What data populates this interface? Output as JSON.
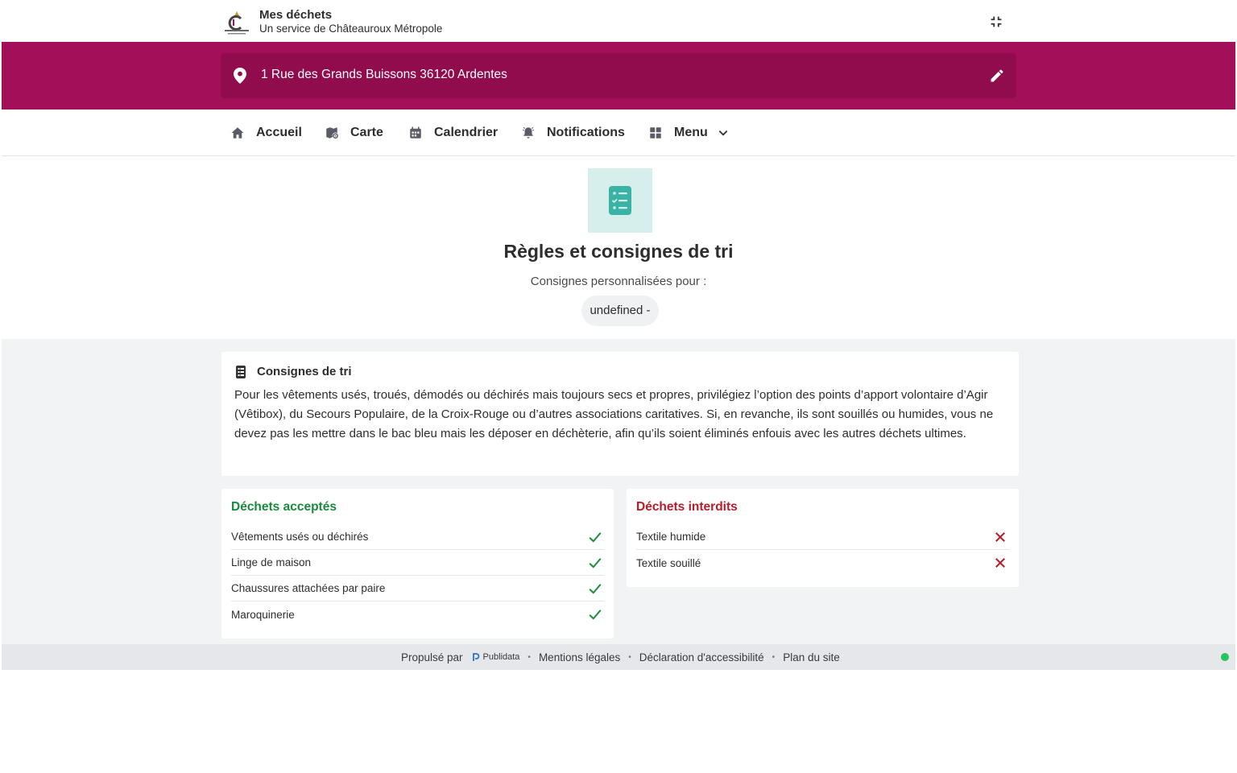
{
  "header": {
    "title": "Mes déchets",
    "subtitle": "Un service de Châteauroux Métropole",
    "logo_icon": "chateauroux-metropole-logo",
    "collapse_icon": "fullscreen-exit-icon"
  },
  "address": {
    "text": "1 Rue des Grands Buissons 36120 Ardentes",
    "pin_icon": "location-pin-icon",
    "edit_icon": "pencil-icon"
  },
  "nav": {
    "items": [
      {
        "label": "Accueil",
        "icon": "home-icon"
      },
      {
        "label": "Carte",
        "icon": "map-icon"
      },
      {
        "label": "Calendrier",
        "icon": "calendar-icon"
      },
      {
        "label": "Notifications",
        "icon": "bell-icon"
      },
      {
        "label": "Menu",
        "icon": "grid-icon"
      }
    ]
  },
  "hero": {
    "title": "Règles et consignes de tri",
    "subtitle": "Consignes personnalisées pour :",
    "chip": "undefined -"
  },
  "instructions": {
    "title": "Consignes de tri",
    "body": "Pour les vêtements usés, troués, démodés ou déchirés mais toujours secs et propres, privilégiez l’option des points d’apport volontaire d’Agir (Vêtibox), du Secours Populaire, de la Croix-Rouge ou d’autres associations caritatives. Si, en revanche, ils sont souillés ou humides, vous ne devez pas les mettre dans le bac bleu mais les déposer en déchèterie, afin qu’ils soient éliminés enfouis avec les autres déchets ultimes."
  },
  "accepted": {
    "title": "Déchets acceptés",
    "items": [
      "Vêtements usés ou déchirés",
      "Linge de maison",
      "Chaussures attachées par paire",
      "Maroquinerie"
    ]
  },
  "rejected": {
    "title": "Déchets interdits",
    "items": [
      "Textile humide",
      "Textile souillé"
    ]
  },
  "footer": {
    "powered_by": "Propulsé par",
    "brand": "Publidata",
    "legal": "Mentions légales",
    "accessibility": "Déclaration d'accessibilité",
    "sitemap": "Plan du site"
  },
  "colors": {
    "brand": "#a30f58",
    "brand_dark": "#900c4d",
    "accept": "#188a3c",
    "reject": "#b81c2a",
    "teal": "#3bb3a4",
    "status": "#22c55e"
  }
}
